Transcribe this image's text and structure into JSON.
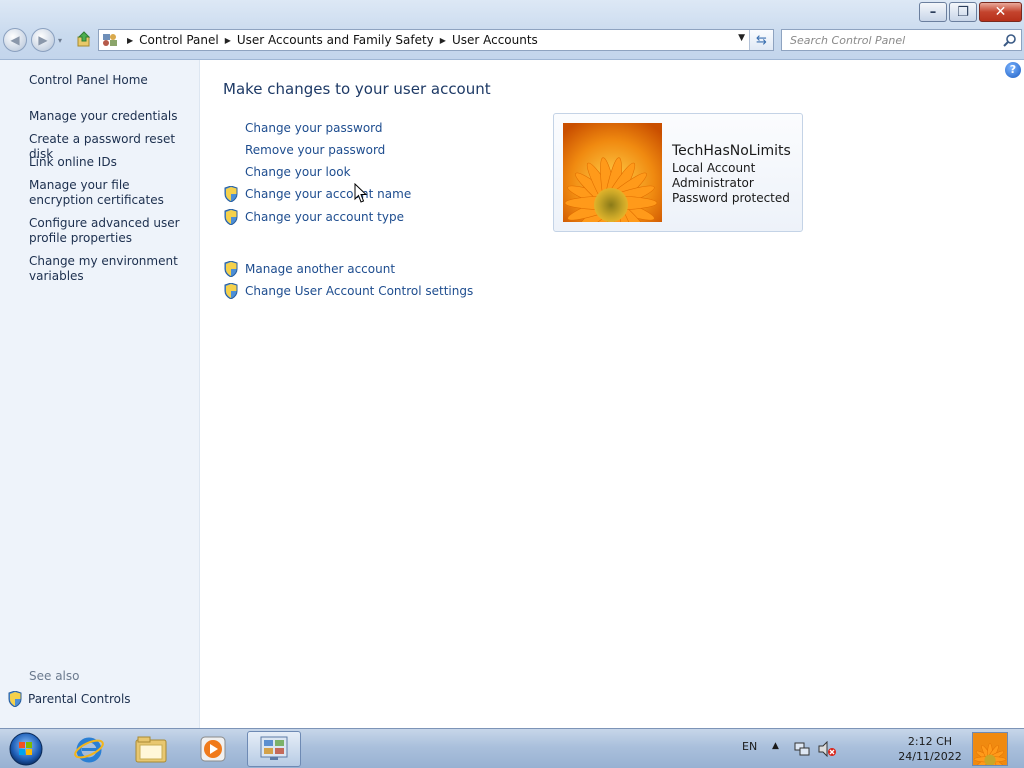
{
  "window": {
    "caption": {
      "minimize_glyph": "–",
      "maximize_glyph": "❐",
      "close_glyph": "✕"
    }
  },
  "navigation": {
    "back_glyph": "◀",
    "forward_glyph": "▶",
    "dropdown_glyph": "▾"
  },
  "breadcrumb": {
    "items": [
      "Control Panel",
      "User Accounts and Family Safety",
      "User Accounts"
    ],
    "separator": "▶",
    "dropdown_glyph": "▼",
    "refresh_glyph": "⇆"
  },
  "search": {
    "placeholder": "Search Control Panel",
    "value": ""
  },
  "sidebar": {
    "links": [
      {
        "label": "Control Panel Home"
      },
      {
        "label": "Manage your credentials"
      },
      {
        "label": "Create a password reset disk"
      },
      {
        "label": "Link online IDs"
      },
      {
        "label": "Manage your file encryption certificates"
      },
      {
        "label": "Configure advanced user profile properties"
      },
      {
        "label": "Change my environment variables"
      }
    ],
    "see_also_label": "See also",
    "see_also_links": [
      {
        "label": "Parental Controls"
      }
    ]
  },
  "main": {
    "help_glyph": "?",
    "title": "Make changes to your user account",
    "tasks": [
      {
        "label": "Change your password",
        "shield": false
      },
      {
        "label": "Remove your password",
        "shield": false
      },
      {
        "label": "Change your look",
        "shield": false
      },
      {
        "label": "Change your account name",
        "shield": true
      },
      {
        "label": "Change your account type",
        "shield": true
      },
      {
        "label": "Manage another account",
        "shield": true
      },
      {
        "label": "Change User Account Control settings",
        "shield": true
      }
    ]
  },
  "user_card": {
    "name": "TechHasNoLimits",
    "lines": [
      "Local Account",
      "Administrator",
      "Password protected"
    ]
  },
  "taskbar": {
    "apps": [
      "windows-start",
      "internet-explorer",
      "windows-explorer",
      "media-player",
      "control-panel"
    ],
    "tray": {
      "language": "EN",
      "expand_glyph": "▲",
      "time": "2:12 CH",
      "date": "24/11/2022"
    }
  },
  "colors": {
    "link": "#1e4d8f",
    "sidebar_bg": "#eef3fa",
    "title": "#1e3a66"
  }
}
